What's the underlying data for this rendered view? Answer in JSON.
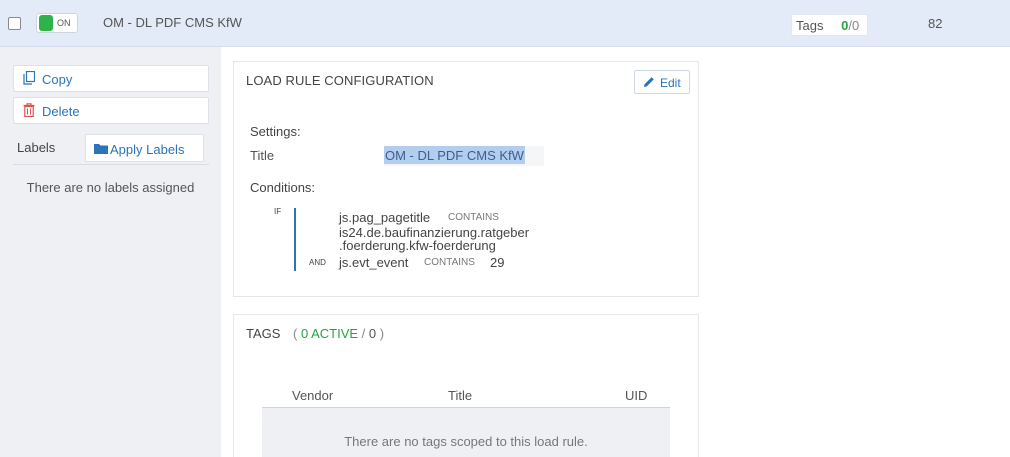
{
  "header": {
    "toggle_label": "ON",
    "title": "OM - DL PDF CMS KfW",
    "tags_label": "Tags",
    "tags_active": "0",
    "tags_sep": "/",
    "tags_total": "0",
    "number": "82",
    "toggle_color": "#2db34a"
  },
  "sidebar": {
    "copy_label": "Copy",
    "delete_label": "Delete",
    "labels_title": "Labels",
    "apply_labels": "Apply Labels",
    "no_labels": "There are no labels assigned"
  },
  "load_rule": {
    "title": "LOAD RULE CONFIGURATION",
    "edit_label": "Edit",
    "settings_label": "Settings:",
    "title_label": "Title",
    "title_value": "OM - DL PDF CMS KfW",
    "conditions_label": "Conditions:",
    "if_label": "IF",
    "and_label": "AND",
    "conditions": [
      {
        "variable": "js.pag_pagetitle",
        "operator": "CONTAINS",
        "value_lines": [
          "is24.de.baufinanzierung.ratgeber",
          ".foerderung.kfw-foerderung"
        ]
      },
      {
        "variable": "js.evt_event",
        "operator": "CONTAINS",
        "value": "29"
      }
    ]
  },
  "tags": {
    "title": "TAGS",
    "open_paren": "(",
    "active_text": "0 ACTIVE",
    "slash": "/",
    "total": "0",
    "close_paren": ")",
    "columns": [
      "Vendor",
      "Title",
      "UID"
    ],
    "empty_message": "There are no tags scoped to this load rule."
  },
  "colors": {
    "accent": "#2a74b8",
    "active_green": "#2aa042",
    "header_bg": "#e3ebf8",
    "sidebar_bg": "#eef0f4"
  }
}
